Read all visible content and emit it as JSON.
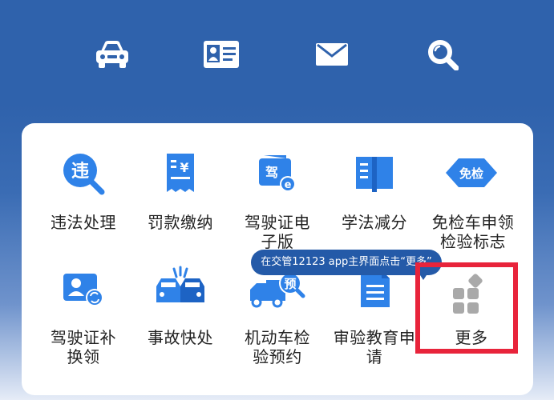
{
  "topbar": {
    "icons": [
      "car-icon",
      "id-card-icon",
      "mail-icon",
      "search-icon"
    ]
  },
  "services": [
    {
      "label": "违法处理",
      "icon": "violation-search-icon",
      "icon_text": "违"
    },
    {
      "label": "罚款缴纳",
      "icon": "fine-receipt-icon",
      "icon_text": "¥"
    },
    {
      "label": "驾驶证电子版",
      "icon": "e-license-icon",
      "icon_text": "驾"
    },
    {
      "label": "学法减分",
      "icon": "book-icon"
    },
    {
      "label": "免检车申领检验标志",
      "icon": "exempt-inspection-icon",
      "icon_text": "免检"
    },
    {
      "label": "驾驶证补换领",
      "icon": "license-renew-icon"
    },
    {
      "label": "事故快处",
      "icon": "accident-icon"
    },
    {
      "label": "机动车检验预约",
      "icon": "vehicle-inspection-booking-icon",
      "icon_text": "预"
    },
    {
      "label": "审验教育申请",
      "icon": "document-icon"
    },
    {
      "label": "更多",
      "icon": "more-grid-icon"
    }
  ],
  "tooltip": {
    "text": "在交管12123 app主界面点击“更多”"
  },
  "colors": {
    "primary": "#2f62ac",
    "icon_blue": "#2f82e8",
    "highlight": "#e8243b",
    "more_gray": "#a9a9a9"
  }
}
